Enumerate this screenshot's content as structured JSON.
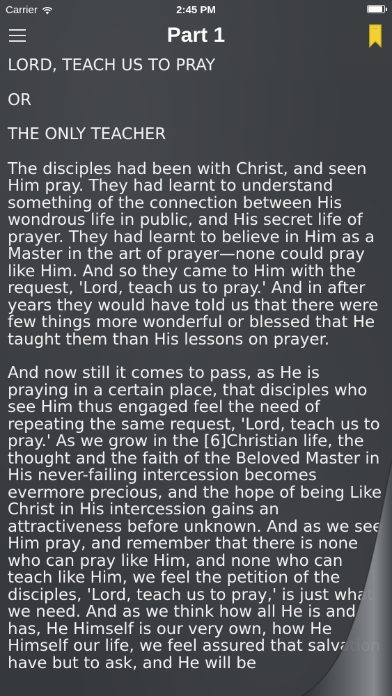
{
  "status_bar": {
    "carrier": "Carrier",
    "time": "2:45 PM",
    "battery_level": 0.95,
    "wifi_icon": "wifi-icon",
    "battery_icon": "battery-icon"
  },
  "nav": {
    "title": "Part 1",
    "menu_icon": "hamburger-menu-icon",
    "bookmark_icon": "bookmark-icon",
    "bookmark_color": "#f2d22e"
  },
  "content": {
    "headings": [
      "LORD, TEACH US TO PRAY",
      "OR",
      "THE ONLY TEACHER"
    ],
    "paragraphs": [
      "The disciples had been with Christ, and seen Him pray. They had learnt to understand something of the connection between His wondrous life in public, and His secret life of prayer. They had learnt to believe in Him as a Master in the art of prayer—none could pray like Him. And so they came to Him with the request, 'Lord, teach us to pray.' And in after years they would have told us that there were few things more wonderful or blessed that He taught them than His lessons on prayer.",
      "And now still it comes to pass, as He is praying in a certain place, that disciples who see Him thus engaged feel the need of repeating the same request, 'Lord, teach us to pray.' As we grow in the [6]Christian life, the thought and the faith of the Beloved Master in His never-failing intercession becomes evermore precious, and the hope of being Like Christ in His intercession gains an attractiveness before unknown. And as we see Him pray, and remember that there is none who can pray like Him, and none who can teach like Him, we feel the petition of the disciples, 'Lord, teach us to pray,' is just what we need. And as we think how all He is and has, He Himself is our very own, how He Himself our life, we feel assured that salvation have but to ask, and He will be"
    ]
  },
  "colors": {
    "background": "#3a3d40",
    "text": "#f2f2f2"
  }
}
